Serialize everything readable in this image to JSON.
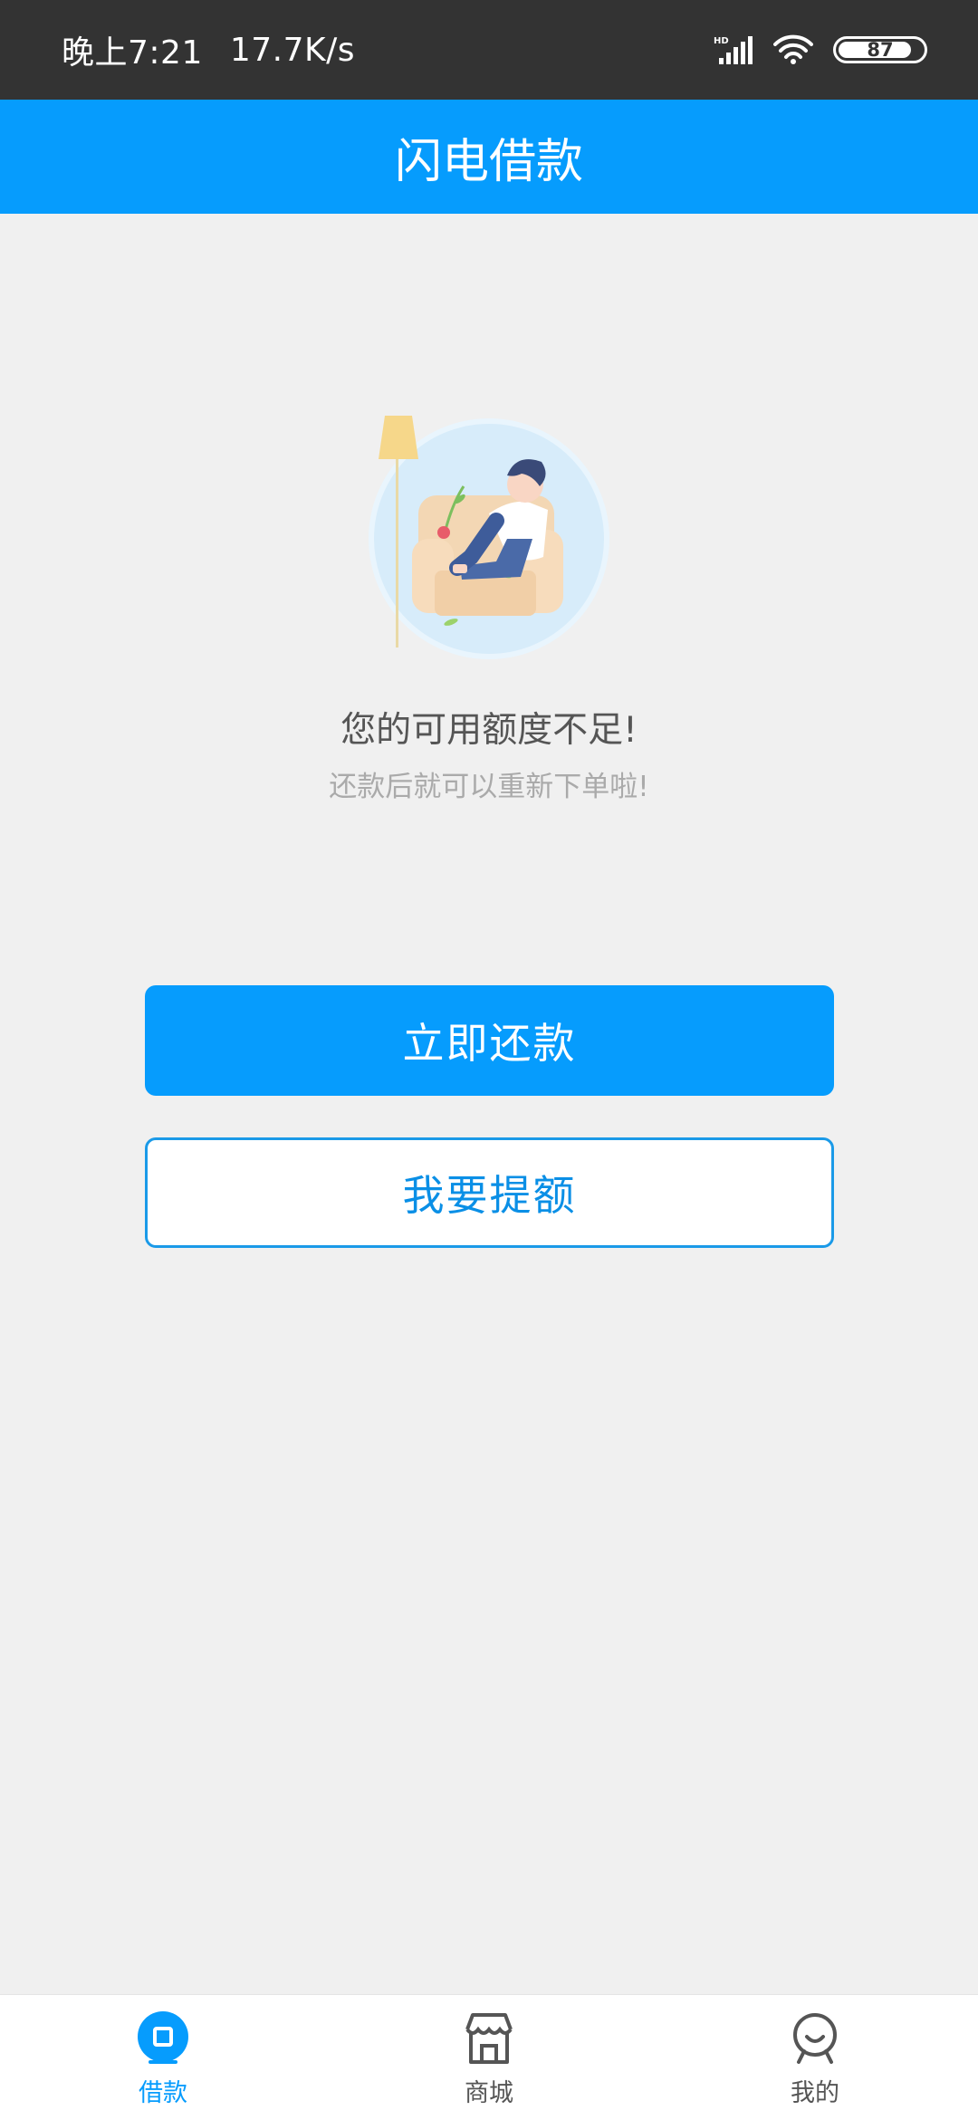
{
  "status_bar": {
    "time": "晚上7:21",
    "net_speed": "17.7K/s",
    "signal_badge": "HD",
    "battery_level": "87",
    "icons": [
      "signal-icon",
      "wifi-icon",
      "battery-icon"
    ]
  },
  "header": {
    "title": "闪电借款"
  },
  "message": {
    "title": "您的可用额度不足!",
    "subtitle": "还款后就可以重新下单啦!"
  },
  "buttons": {
    "repay": "立即还款",
    "raise_limit": "我要提额"
  },
  "tabbar": {
    "items": [
      {
        "label": "借款",
        "icon": "loan-icon",
        "active": true
      },
      {
        "label": "商城",
        "icon": "store-icon",
        "active": false
      },
      {
        "label": "我的",
        "icon": "profile-icon",
        "active": false
      }
    ]
  },
  "colors": {
    "primary": "#069cfd",
    "status_bar": "#333333",
    "background": "#f0f0f0"
  }
}
